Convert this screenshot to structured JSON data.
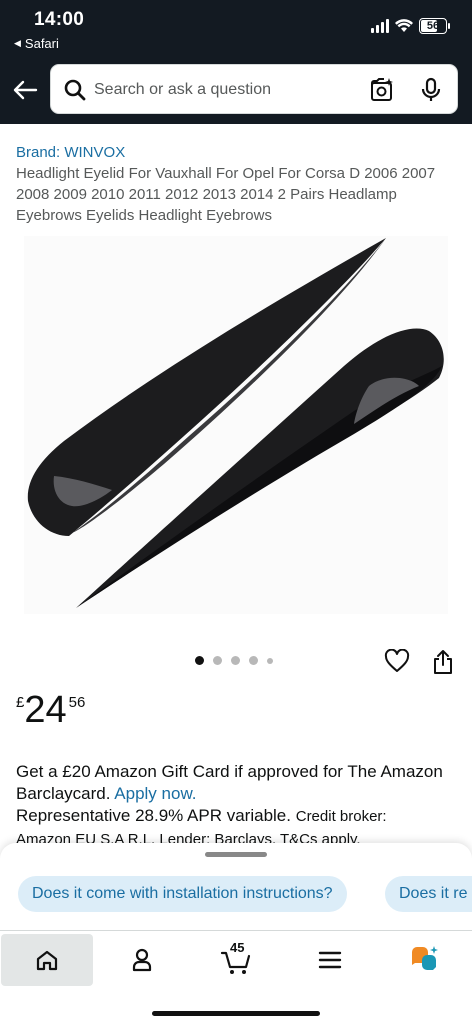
{
  "status_bar": {
    "time": "14:00",
    "back_app": "Safari",
    "battery": "56"
  },
  "header": {
    "search_placeholder": "Search or ask a question"
  },
  "product": {
    "brand": "Brand: WINVOX",
    "title": "Headlight Eyelid For Vauxhall For Opel For Corsa D 2006 2007 2008 2009 2010 2011 2012 2013 2014 2 Pairs Headlamp Eyebrows Eyelids Headlight Eyebrows",
    "image_count": 5,
    "active_image": 1,
    "price": {
      "symbol": "£",
      "whole": "24",
      "fraction": "56"
    }
  },
  "promo": {
    "line1": "Get a £20 Amazon Gift Card if approved for The Amazon Barclaycard.",
    "apply_link": "Apply now.",
    "line2": "Representative 28.9% APR variable.",
    "line2_small": "Credit broker:",
    "line3": "Amazon EU S.A R.L. Lender: Barclays. T&Cs apply."
  },
  "questions": [
    "Does it come with installation instructions?",
    "Does it re"
  ],
  "tabbar": {
    "cart_count": "45",
    "items": [
      "home-icon",
      "account-icon",
      "cart-icon",
      "menu-icon",
      "rufus-icon"
    ]
  },
  "colors": {
    "header_bg": "#131a22",
    "link": "#1a6ea2",
    "chip_bg": "#dcedf8"
  }
}
